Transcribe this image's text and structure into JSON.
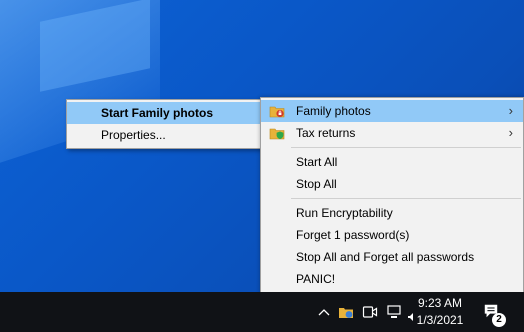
{
  "submenu": {
    "items": [
      {
        "label": "Start Family photos",
        "bold": true
      },
      {
        "label": "Properties..."
      }
    ]
  },
  "menu": {
    "vaults": [
      {
        "label": "Family photos",
        "icon": "locked-folder-icon"
      },
      {
        "label": "Tax returns",
        "icon": "shielded-folder-icon"
      }
    ],
    "group2": [
      {
        "label": "Start All"
      },
      {
        "label": "Stop All"
      }
    ],
    "group3": [
      {
        "label": "Run Encryptability"
      },
      {
        "label": "Forget 1 password(s)"
      },
      {
        "label": "Stop All and Forget all passwords"
      },
      {
        "label": "PANIC!"
      }
    ]
  },
  "taskbar": {
    "time": "9:23 AM",
    "date": "1/3/2021",
    "notification_count": "2"
  }
}
